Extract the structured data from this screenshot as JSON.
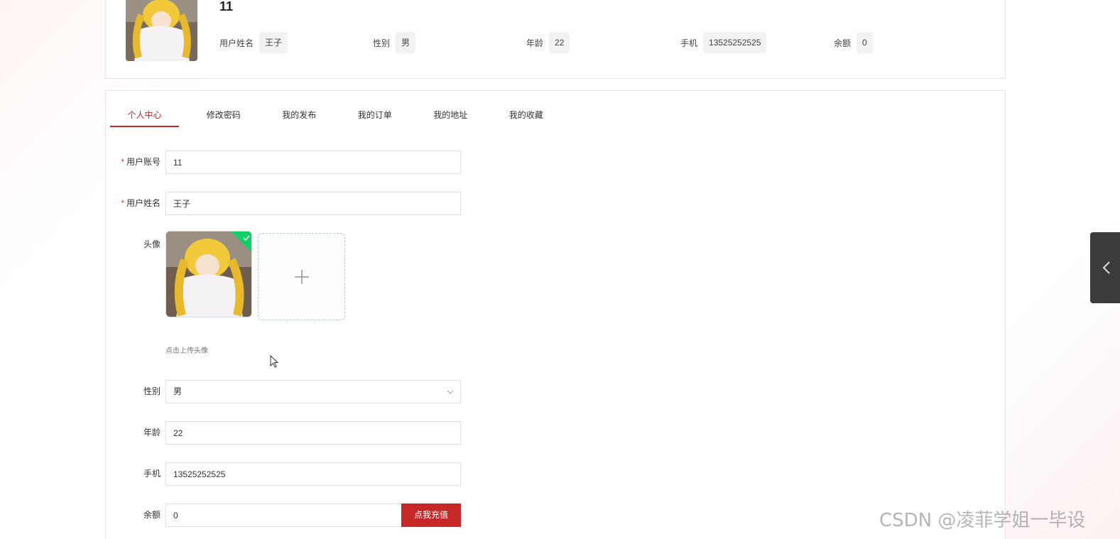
{
  "profile": {
    "name": "11",
    "fields": [
      {
        "label": "用户姓名",
        "value": "王子"
      },
      {
        "label": "性别",
        "value": "男"
      },
      {
        "label": "年龄",
        "value": "22"
      },
      {
        "label": "手机",
        "value": "13525252525"
      },
      {
        "label": "余额",
        "value": "0"
      }
    ]
  },
  "tabs": [
    {
      "label": "个人中心",
      "active": true
    },
    {
      "label": "修改密码",
      "active": false
    },
    {
      "label": "我的发布",
      "active": false
    },
    {
      "label": "我的订单",
      "active": false
    },
    {
      "label": "我的地址",
      "active": false
    },
    {
      "label": "我的收藏",
      "active": false
    }
  ],
  "form": {
    "account": {
      "label": "用户账号",
      "value": "11",
      "required": true
    },
    "name": {
      "label": "用户姓名",
      "value": "王子",
      "required": true
    },
    "avatar": {
      "label": "头像",
      "tip": "点击上传头像"
    },
    "gender": {
      "label": "性别",
      "value": "男"
    },
    "age": {
      "label": "年龄",
      "value": "22"
    },
    "phone": {
      "label": "手机",
      "value": "13525252525"
    },
    "balance": {
      "label": "余额",
      "value": "0",
      "button": "点我充值"
    }
  },
  "watermark": "CSDN @凌菲学姐一毕设",
  "colors": {
    "accent": "#c62828",
    "success": "#13ce66"
  },
  "icons": [
    "avatar-image",
    "checkmark-icon",
    "plus-icon",
    "chevron-down-icon",
    "chevron-left-icon",
    "mouse-cursor-icon"
  ]
}
